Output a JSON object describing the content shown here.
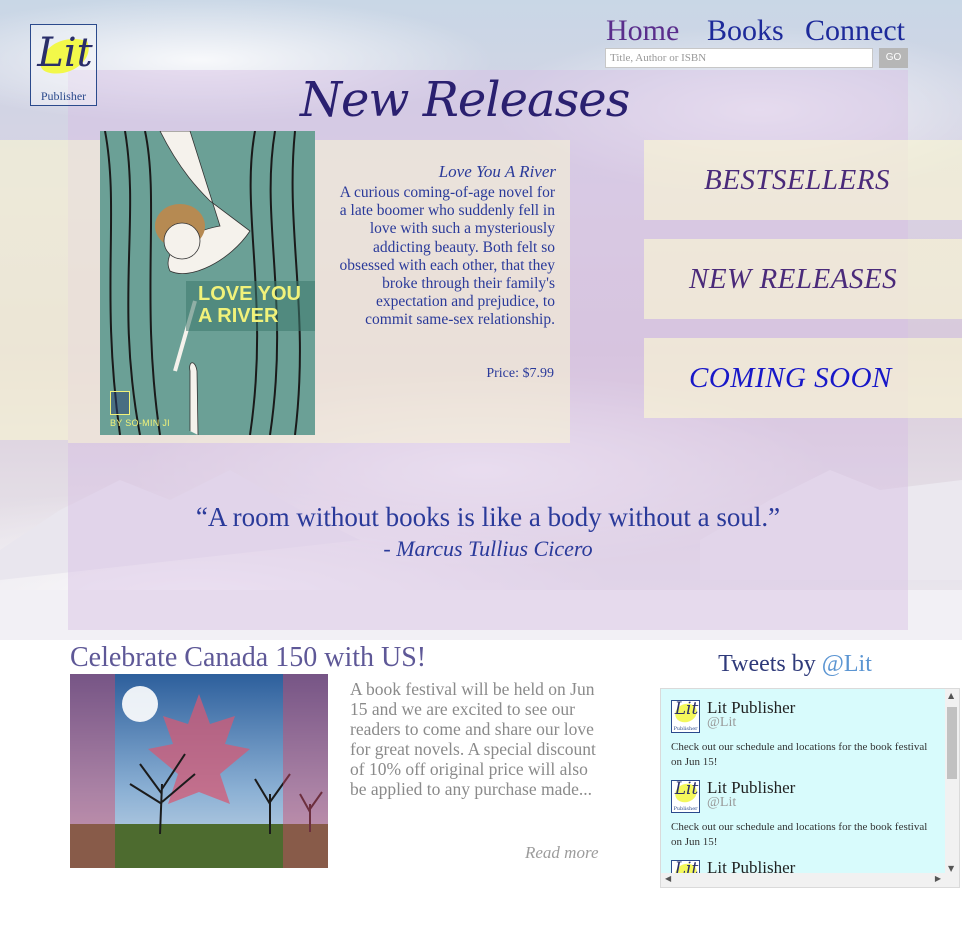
{
  "brand": {
    "logo_text": "Lit",
    "logo_subtitle": "Publisher"
  },
  "nav": {
    "items": [
      {
        "label": "Home",
        "color": "#5a2d8c"
      },
      {
        "label": "Books",
        "color": "#1d2a9a"
      },
      {
        "label": "Connect",
        "color": "#1d2a9a"
      }
    ]
  },
  "search": {
    "placeholder": "Title, Author or ISBN",
    "button_label": "GO"
  },
  "featured": {
    "heading": "New Releases",
    "book": {
      "cover_title": "LOVE YOU A RIVER",
      "cover_author": "BY SO-MIN JI",
      "title": "Love You A River",
      "description": "A curious coming-of-age novel for a late boomer who suddenly fell in love with such a mysteriously addicting beauty. Both felt so obsessed with each other, that they broke through their family's expectation and prejudice, to commit same-sex relationship.",
      "price": "Price: $7.99"
    }
  },
  "categories": [
    {
      "label": "BESTSELLERS",
      "color": "#4a2a7a"
    },
    {
      "label": "NEW RELEASES",
      "color": "#4a2a7a"
    },
    {
      "label": "COMING SOON",
      "color": "#1818c8"
    }
  ],
  "quote": {
    "text": "“A room without books is like a body without a soul.”",
    "author": "- Marcus Tullius Cicero"
  },
  "news": {
    "title": "Celebrate Canada 150 with US!",
    "body": "A book festival will be held on Jun 15 and we are excited to see our readers to come and share our love for great novels. A special discount of 10% off original price will also be applied to any purchase made...",
    "read_more": "Read more"
  },
  "tweets": {
    "title_prefix": "Tweets by",
    "title_handle": "@Lit",
    "items": [
      {
        "name": "Lit Publisher",
        "handle": "@Lit",
        "text": "Check out our schedule and locations for the book festival on Jun 15!"
      },
      {
        "name": "Lit Publisher",
        "handle": "@Lit",
        "text": "Check out our schedule and locations for the book festival on Jun 15!"
      },
      {
        "name": "Lit Publisher",
        "handle": "",
        "text": ""
      }
    ]
  }
}
